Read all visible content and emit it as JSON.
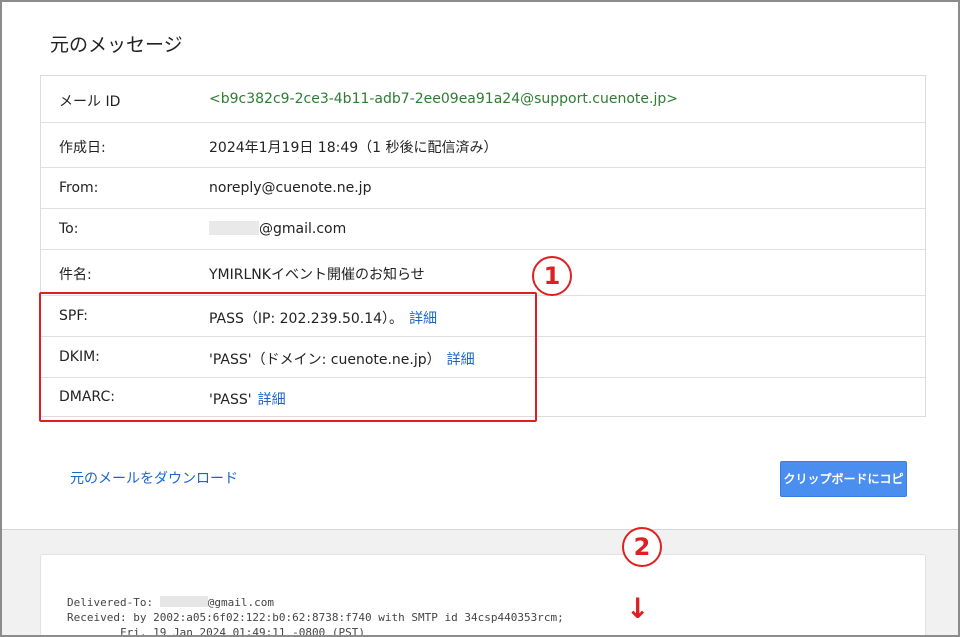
{
  "page_title": "元のメッセージ",
  "headers": {
    "message_id": {
      "label": "メール ID",
      "value": "<b9c382c9-2ce3-4b11-adb7-2ee09ea91a24@support.cuenote.jp>"
    },
    "created": {
      "label": "作成日:",
      "value": "2024年1月19日 18:49（1 秒後に配信済み）"
    },
    "from": {
      "label": "From:",
      "value": "noreply@cuenote.ne.jp"
    },
    "to": {
      "label": "To:",
      "value": "@gmail.com"
    },
    "subject": {
      "label": "件名:",
      "value": "YMIRLNKイベント開催のお知らせ"
    },
    "spf": {
      "label": "SPF:",
      "value": "PASS（IP: 202.239.50.14）。",
      "link": "詳細"
    },
    "dkim": {
      "label": "DKIM:",
      "value": "'PASS'（ドメイン: cuenote.ne.jp）",
      "link": "詳細"
    },
    "dmarc": {
      "label": "DMARC:",
      "value": "'PASS'",
      "link": "詳細"
    }
  },
  "annotations": {
    "one": "1",
    "two": "2",
    "arrow": "↓"
  },
  "actions": {
    "download": "元のメールをダウンロード",
    "copy": "クリップボードにコピー"
  },
  "raw": {
    "line1_prefix": "Delivered-To: ",
    "line1_suffix": "@gmail.com",
    "line2": "Received: by 2002:a05:6f02:122:b0:62:8738:f740 with SMTP id 34csp440353rcm;",
    "line3": "        Fri, 19 Jan 2024 01:49:11 -0800 (PST)"
  },
  "colors": {
    "accent_red": "#e02020",
    "link_blue": "#1a66c9",
    "id_green": "#2e7d32",
    "button_blue": "#4a8ef0"
  }
}
